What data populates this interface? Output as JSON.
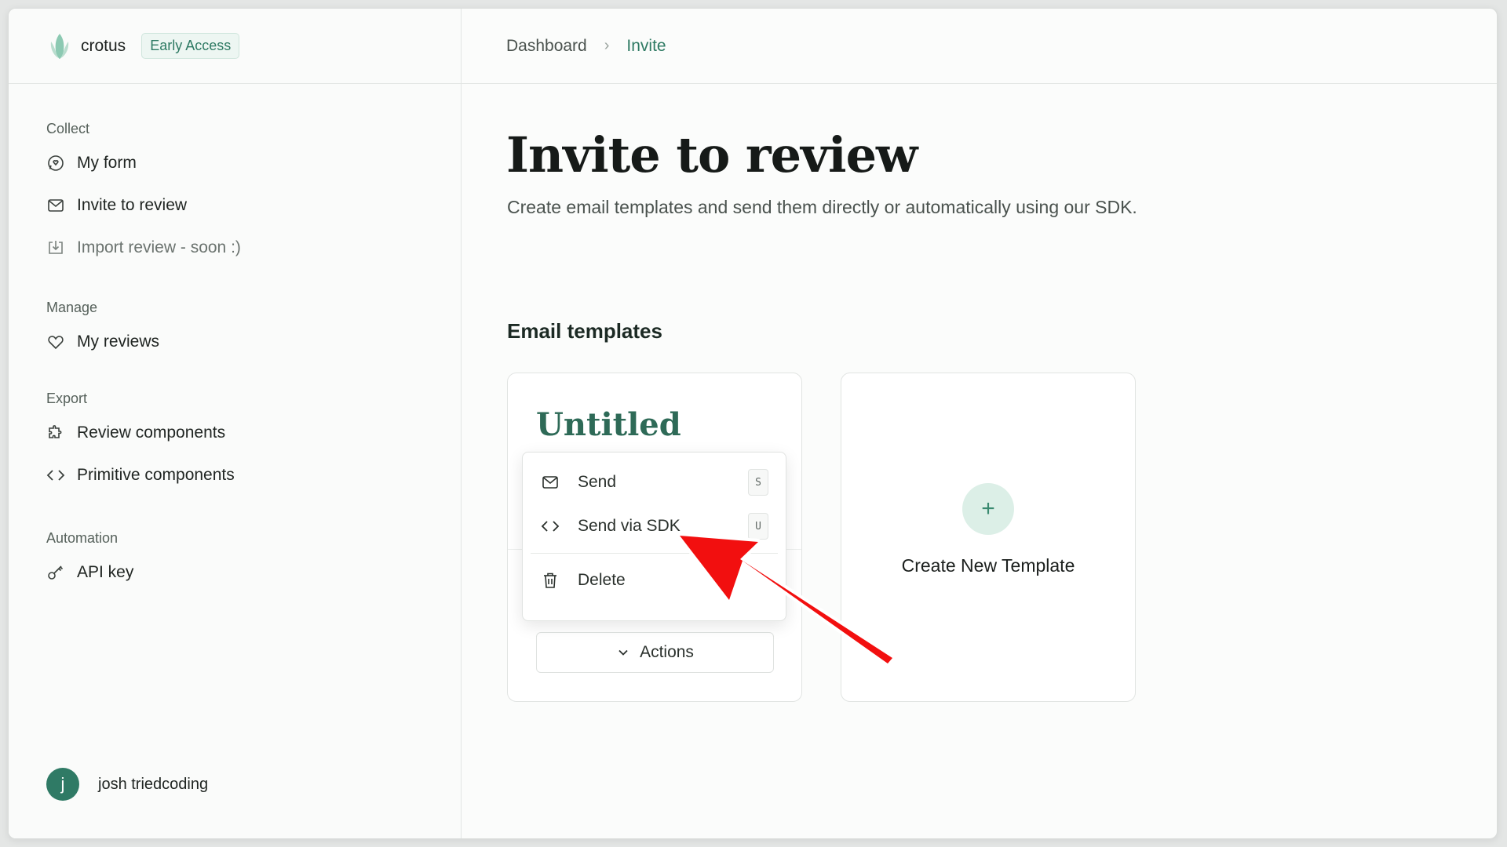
{
  "brand": {
    "name": "crotus",
    "badge": "Early Access"
  },
  "sidebar": {
    "sections": [
      {
        "label": "Collect",
        "items": [
          {
            "label": "My form",
            "icon": "chat-icon"
          },
          {
            "label": "Invite to review",
            "icon": "mail-icon"
          },
          {
            "label": "Import review - soon :)",
            "icon": "import-icon",
            "disabled": true
          }
        ]
      },
      {
        "label": "Manage",
        "items": [
          {
            "label": "My reviews",
            "icon": "heart-icon"
          }
        ]
      },
      {
        "label": "Export",
        "items": [
          {
            "label": "Review components",
            "icon": "puzzle-icon"
          },
          {
            "label": "Primitive components",
            "icon": "code-icon"
          }
        ]
      },
      {
        "label": "Automation",
        "items": [
          {
            "label": "API key",
            "icon": "key-icon"
          }
        ]
      }
    ],
    "user": {
      "initial": "j",
      "name": "josh triedcoding"
    }
  },
  "breadcrumb": {
    "parent": "Dashboard",
    "separator": "›",
    "current": "Invite"
  },
  "page": {
    "title": "Invite to review",
    "subtitle": "Create email templates and send them directly or automatically using our SDK.",
    "section_title": "Email templates"
  },
  "template_card": {
    "name": "Untitled",
    "actions_label": "Actions",
    "menu": [
      {
        "label": "Send",
        "shortcut": "S",
        "icon": "mail-icon"
      },
      {
        "label": "Send via SDK",
        "shortcut": "U",
        "icon": "code-icon"
      },
      {
        "label": "Delete",
        "shortcut": "",
        "icon": "trash-icon"
      }
    ]
  },
  "new_card": {
    "label": "Create New Template",
    "icon": "+"
  },
  "colors": {
    "accent": "#2e7a63",
    "annotation_arrow": "#f20f0f"
  }
}
